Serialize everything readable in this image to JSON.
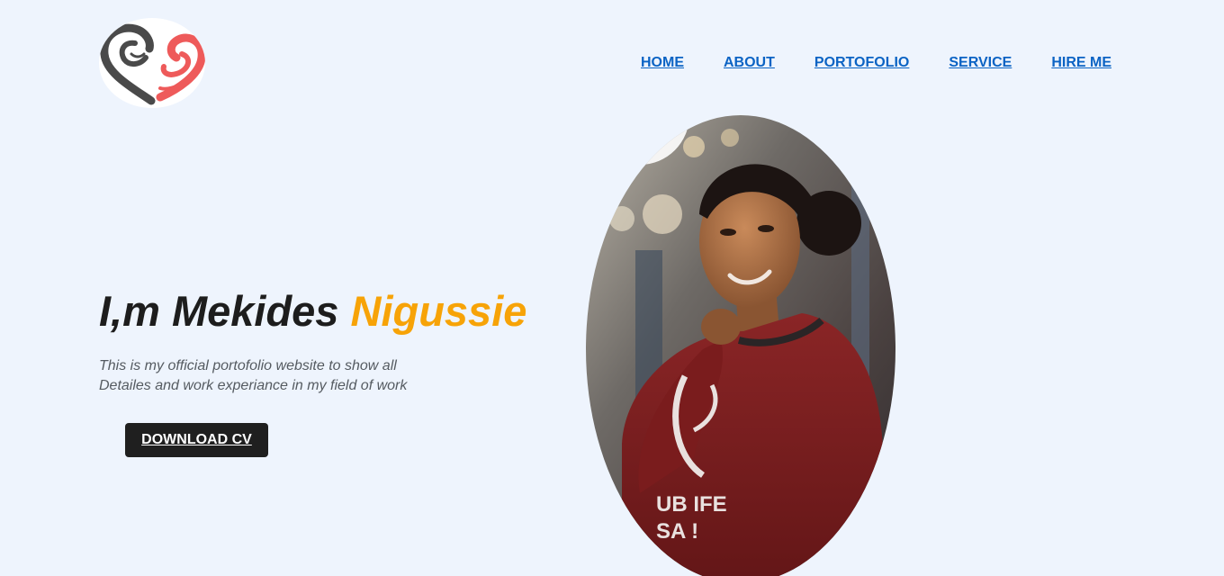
{
  "logo": {
    "icon": "heart-profile-logo-icon",
    "colors": {
      "dark": "#4a4a4a",
      "accent": "#ee5a5a"
    }
  },
  "nav": {
    "items": [
      {
        "label": "HOME"
      },
      {
        "label": "ABOUT"
      },
      {
        "label": "PORTOFOLIO"
      },
      {
        "label": "SERVICE"
      },
      {
        "label": "HIRE ME"
      }
    ]
  },
  "hero": {
    "title_prefix": "I,m Mekides ",
    "title_accent": "Nigussie",
    "description": "This is my official portofolio website to show all Detailes and work experiance in my field of work",
    "cta_label": "DOWNLOAD CV"
  },
  "portrait": {
    "image": "portrait-photo",
    "sweater_text_1": "UB IFE",
    "sweater_text_2": "SA !"
  },
  "colors": {
    "background": "#eef4fd",
    "link": "#0b63c4",
    "accent": "#f7a307",
    "button": "#1f1f1f",
    "sweater": "#7a1c1d"
  }
}
